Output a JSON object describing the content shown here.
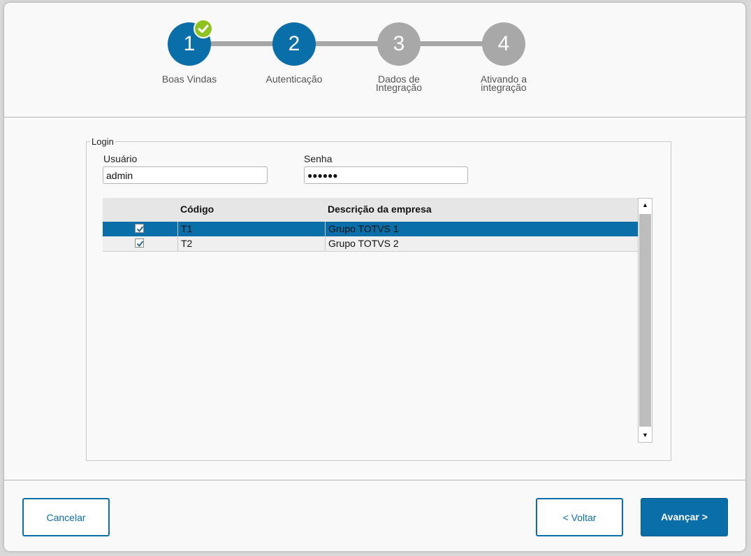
{
  "colors": {
    "accent": "#0a6ea8",
    "step_inactive": "#a8a8a8",
    "step_done_check": "#8dc21f",
    "selected_row": "#0a6ea8"
  },
  "wizard": {
    "steps": [
      {
        "number": "1",
        "label_lines": [
          "Boas Vindas"
        ],
        "state": "completed"
      },
      {
        "number": "2",
        "label_lines": [
          "Autenticação"
        ],
        "state": "active"
      },
      {
        "number": "3",
        "label_lines": [
          "Dados de",
          "Integração"
        ],
        "state": "inactive"
      },
      {
        "number": "4",
        "label_lines": [
          "Ativando a",
          "integração"
        ],
        "state": "inactive"
      }
    ]
  },
  "login": {
    "legend": "Login",
    "user_label": "Usuário",
    "user_value": "admin",
    "password_label": "Senha",
    "password_value": "●●●●●●"
  },
  "grid": {
    "columns": [
      "",
      "Código",
      "Descrição da empresa"
    ],
    "rows": [
      {
        "checked": true,
        "code": "T1",
        "description": "Grupo TOTVS 1",
        "selected": true
      },
      {
        "checked": true,
        "code": "T2",
        "description": "Grupo TOTVS 2",
        "selected": false
      }
    ],
    "scroll_up_icon": "triangle-up-icon",
    "scroll_down_icon": "triangle-down-icon"
  },
  "buttons": {
    "cancel": "Cancelar",
    "back": "< Voltar",
    "next": "Avançar >"
  }
}
